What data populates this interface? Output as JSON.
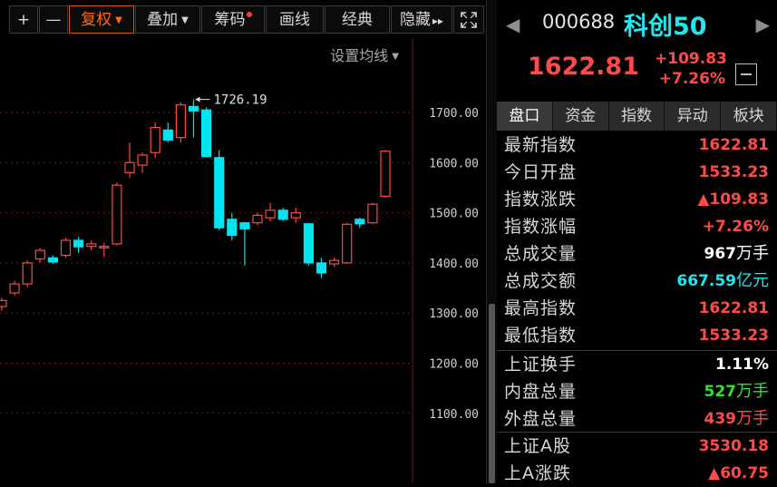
{
  "toolbar": {
    "plus": "+",
    "minus": "—",
    "adjust": "复权",
    "overlay": "叠加",
    "chips": "筹码",
    "draw": "画线",
    "classic": "经典",
    "hide": "隐藏",
    "hide_arrow": "▸▸"
  },
  "chart": {
    "ma_setting": "设置均线",
    "y_ticks": [
      "1700.00",
      "1600.00",
      "1500.00",
      "1400.00",
      "1300.00",
      "1200.00",
      "1100.00"
    ],
    "high_marker": "1726.19",
    "colors": {
      "up": "#ff4848",
      "down": "#00e5ef",
      "grid": "#7a1515"
    }
  },
  "chart_data": {
    "type": "candlestick",
    "y_ticks": [
      1700,
      1600,
      1500,
      1400,
      1300,
      1200,
      1100
    ],
    "annotation": "1726.19",
    "candles": [
      {
        "o": 1313,
        "h": 1330,
        "l": 1305,
        "c": 1325
      },
      {
        "o": 1340,
        "h": 1365,
        "l": 1335,
        "c": 1358
      },
      {
        "o": 1358,
        "h": 1405,
        "l": 1352,
        "c": 1400
      },
      {
        "o": 1408,
        "h": 1430,
        "l": 1400,
        "c": 1425
      },
      {
        "o": 1410,
        "h": 1415,
        "l": 1398,
        "c": 1402
      },
      {
        "o": 1415,
        "h": 1450,
        "l": 1410,
        "c": 1445
      },
      {
        "o": 1445,
        "h": 1452,
        "l": 1420,
        "c": 1432
      },
      {
        "o": 1433,
        "h": 1445,
        "l": 1425,
        "c": 1438
      },
      {
        "o": 1430,
        "h": 1440,
        "l": 1412,
        "c": 1433
      },
      {
        "o": 1438,
        "h": 1560,
        "l": 1435,
        "c": 1555
      },
      {
        "o": 1580,
        "h": 1640,
        "l": 1570,
        "c": 1600
      },
      {
        "o": 1595,
        "h": 1620,
        "l": 1580,
        "c": 1615
      },
      {
        "o": 1620,
        "h": 1680,
        "l": 1610,
        "c": 1670
      },
      {
        "o": 1665,
        "h": 1680,
        "l": 1640,
        "c": 1645
      },
      {
        "o": 1650,
        "h": 1720,
        "l": 1640,
        "c": 1715
      },
      {
        "o": 1712,
        "h": 1726,
        "l": 1650,
        "c": 1703
      },
      {
        "o": 1705,
        "h": 1710,
        "l": 1610,
        "c": 1612
      },
      {
        "o": 1610,
        "h": 1625,
        "l": 1465,
        "c": 1470
      },
      {
        "o": 1487,
        "h": 1500,
        "l": 1445,
        "c": 1455
      },
      {
        "o": 1480,
        "h": 1482,
        "l": 1395,
        "c": 1468
      },
      {
        "o": 1480,
        "h": 1500,
        "l": 1475,
        "c": 1495
      },
      {
        "o": 1490,
        "h": 1520,
        "l": 1483,
        "c": 1505
      },
      {
        "o": 1505,
        "h": 1510,
        "l": 1484,
        "c": 1487
      },
      {
        "o": 1490,
        "h": 1510,
        "l": 1480,
        "c": 1500
      },
      {
        "o": 1478,
        "h": 1480,
        "l": 1395,
        "c": 1400
      },
      {
        "o": 1400,
        "h": 1410,
        "l": 1370,
        "c": 1380
      },
      {
        "o": 1398,
        "h": 1410,
        "l": 1392,
        "c": 1405
      },
      {
        "o": 1400,
        "h": 1480,
        "l": 1398,
        "c": 1477
      },
      {
        "o": 1487,
        "h": 1490,
        "l": 1470,
        "c": 1478
      },
      {
        "o": 1480,
        "h": 1520,
        "l": 1478,
        "c": 1517
      },
      {
        "o": 1533,
        "h": 1623,
        "l": 1530,
        "c": 1623
      }
    ]
  },
  "quote": {
    "code": "000688",
    "name": "科创50",
    "price": "1622.81",
    "change": "+109.83",
    "change_pct": "+7.26%"
  },
  "tabs": [
    "盘口",
    "资金",
    "指数",
    "异动",
    "板块"
  ],
  "stats1": [
    {
      "label": "最新指数",
      "value": "1622.81",
      "unit": "",
      "color": "#ff4a4a"
    },
    {
      "label": "今日开盘",
      "value": "1533.23",
      "unit": "",
      "color": "#ff4a4a"
    },
    {
      "label": "指数涨跌",
      "value": "▲109.83",
      "unit": "",
      "color": "#ff4a4a"
    },
    {
      "label": "指数涨幅",
      "value": "+7.26%",
      "unit": "",
      "color": "#ff4a4a"
    },
    {
      "label": "总成交量",
      "value": "967",
      "unit": "万手",
      "color": "#ffffff"
    },
    {
      "label": "总成交额",
      "value": "667.59",
      "unit": "亿元",
      "color": "#22e6ef"
    },
    {
      "label": "最高指数",
      "value": "1622.81",
      "unit": "",
      "color": "#ff4a4a"
    },
    {
      "label": "最低指数",
      "value": "1533.23",
      "unit": "",
      "color": "#ff4a4a"
    }
  ],
  "stats2": [
    {
      "label": "上证换手",
      "value": "1.11%",
      "unit": "",
      "color": "#ffffff"
    },
    {
      "label": "内盘总量",
      "value": "527",
      "unit": "万手",
      "color": "#33e033"
    },
    {
      "label": "外盘总量",
      "value": "439",
      "unit": "万手",
      "color": "#ff4a4a"
    }
  ],
  "stats3": [
    {
      "label": "上证A股",
      "value": "3530.18",
      "unit": "",
      "color": "#ff4a4a"
    },
    {
      "label": "上A涨跌",
      "value": "▲60.75",
      "unit": "",
      "color": "#ff4a4a"
    }
  ]
}
